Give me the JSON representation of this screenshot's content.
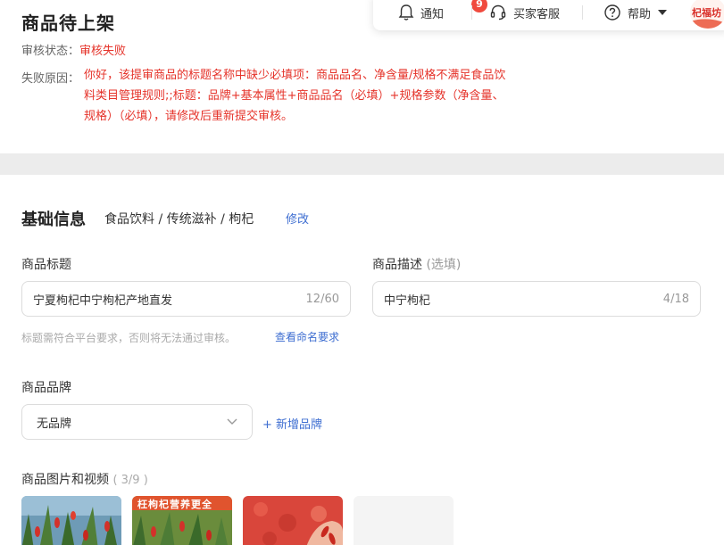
{
  "header": {
    "title": "商品待上架",
    "status_label": "审核状态：",
    "status_value": "审核失败",
    "reason_label": "失败原因：",
    "reason_text": "你好，该提审商品的标题名称中缺少必填项：商品品名、净含量/规格不满足食品饮料类目管理规则;;标题：品牌+基本属性+商品品名（必填）+规格参数（净含量、规格）（必填），请修改后重新提交审核。"
  },
  "topbar": {
    "notify_label": "通知",
    "notify_badge": "9",
    "service_label": "买家客服",
    "help_label": "帮助",
    "avatar_text": "杞福坊"
  },
  "basic": {
    "section_title": "基础信息",
    "category": "食品饮料 / 传统滋补 / 枸杞",
    "edit_label": "修改",
    "title_label": "商品标题",
    "title_value": "宁夏枸杞中宁枸杞产地直发",
    "title_count": "12/60",
    "desc_label": "商品描述",
    "desc_optional": "(选填)",
    "desc_value": "中宁枸杞",
    "desc_count": "4/18",
    "hint_text": "标题需符合平台要求，否则将无法通过审核。",
    "hint_link": "查看命名要求",
    "brand_label": "商品品牌",
    "brand_value": "无品牌",
    "add_brand": "+ 新增品牌",
    "media_label": "商品图片和视频",
    "media_count": "( 3/9 )",
    "thumb2_banner": "枉枸杞营养更全"
  },
  "colors": {
    "error": "#e5332a",
    "link": "#3e6ed1",
    "badge": "#f04a3e"
  }
}
